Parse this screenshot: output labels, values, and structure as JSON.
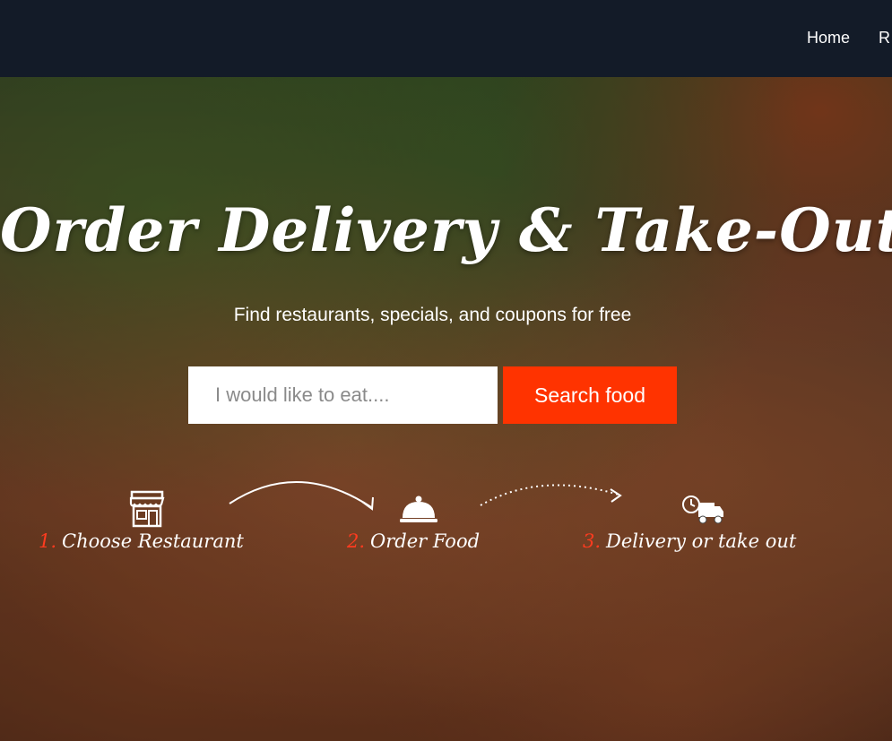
{
  "nav": {
    "items": [
      {
        "label": "Home"
      },
      {
        "label": "R"
      }
    ]
  },
  "hero": {
    "title": "Order Delivery & Take-Out",
    "subtitle": "Find restaurants, specials, and coupons for free"
  },
  "search": {
    "placeholder": "I would like to eat....",
    "button_label": "Search food"
  },
  "steps": [
    {
      "number": "1.",
      "label": "Choose Restaurant",
      "icon": "store-icon"
    },
    {
      "number": "2.",
      "label": "Order Food",
      "icon": "cloche-icon"
    },
    {
      "number": "3.",
      "label": "Delivery or take out",
      "icon": "delivery-truck-icon"
    }
  ],
  "colors": {
    "accent": "#ff3300",
    "nav_bg": "#131b28",
    "step_number": "#ff3b1f"
  }
}
